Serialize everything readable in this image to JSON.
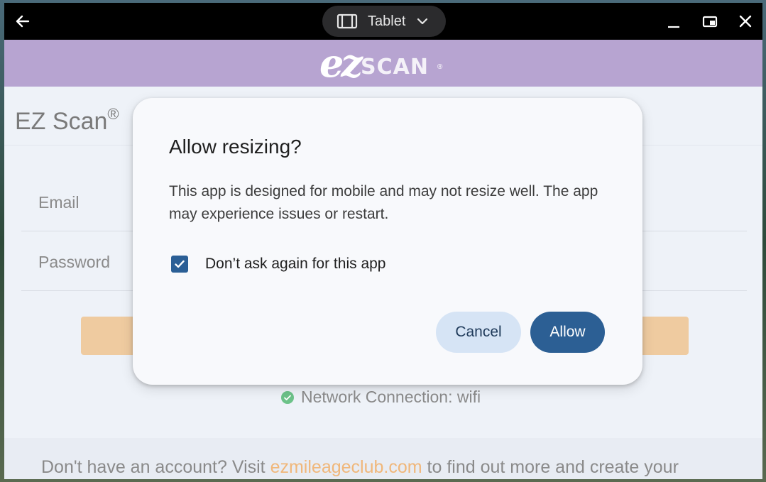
{
  "titlebar": {
    "mode_label": "Tablet"
  },
  "brand": {
    "logo_ez": "ez",
    "logo_scan": "SCAN",
    "logo_reg": "®"
  },
  "page": {
    "app_title": "EZ Scan",
    "app_title_reg": "®",
    "email_placeholder": "Email",
    "password_placeholder": "Password",
    "network_status": "Network Connection: wifi",
    "footer_prefix": "Don't have an account? Visit ",
    "footer_link": "ezmileageclub.com",
    "footer_suffix": " to find out more and create your"
  },
  "dialog": {
    "title": "Allow resizing?",
    "body": "This app is designed for mobile and may not resize well. The app may experience issues or restart.",
    "checkbox_label": "Don’t ask again for this app",
    "checkbox_checked": true,
    "cancel_label": "Cancel",
    "allow_label": "Allow"
  },
  "colors": {
    "brand_purple": "#b7a4d1",
    "login_button": "#efcba0",
    "link": "#f0b77a",
    "primary_button": "#2c5f94",
    "secondary_button": "#d6e4f5",
    "checkbox": "#2b5f96",
    "status_ok": "#6cc289"
  },
  "icons": {
    "back": "arrow-left-icon",
    "mode": "tablet-frame-icon",
    "mode_chevron": "chevron-down-icon",
    "minimize": "minimize-icon",
    "maximize": "restore-window-icon",
    "close": "close-icon",
    "network_ok": "check-circle-icon",
    "checkbox": "checkmark-icon"
  }
}
